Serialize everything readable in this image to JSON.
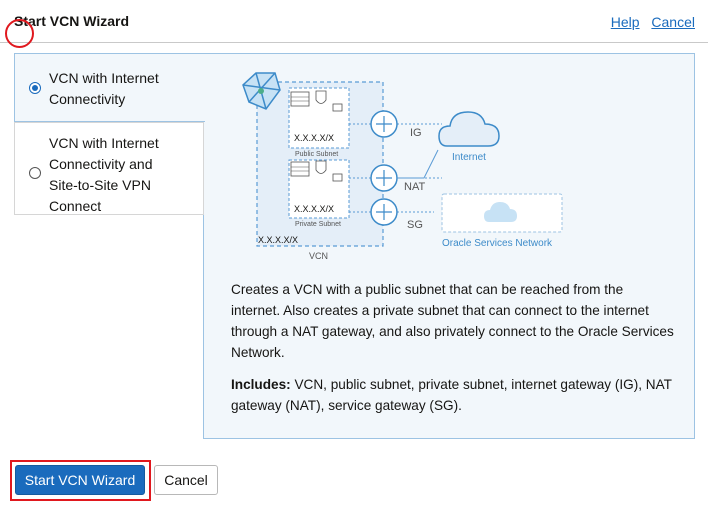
{
  "header": {
    "title": "Start VCN Wizard",
    "help_link": "Help",
    "cancel_link": "Cancel"
  },
  "options": [
    {
      "label_line1": "VCN with Internet",
      "label_line2": "Connectivity",
      "selected": true
    },
    {
      "label_line1": "VCN with Internet",
      "label_line2": "Connectivity and",
      "label_line3": "Site-to-Site VPN",
      "label_line4": "Connect",
      "selected": false
    }
  ],
  "diagram": {
    "public_subnet_cidr": "X.X.X.X/X",
    "public_subnet_label": "Public Subnet",
    "private_subnet_cidr": "X.X.X.X/X",
    "private_subnet_label": "Private Subnet",
    "vcn_cidr": "X.X.X.X/X",
    "vcn_label": "VCN",
    "ig_label": "IG",
    "nat_label": "NAT",
    "sg_label": "SG",
    "internet_label": "Internet",
    "osn_label": "Oracle Services Network",
    "accent_color": "#5a9bd5"
  },
  "description": {
    "text": "Creates a VCN with a public subnet that can be reached from the internet. Also creates a private subnet that can connect to the internet through a NAT gateway, and also privately connect to the Oracle Services Network.",
    "includes_label": "Includes:",
    "includes_text": " VCN, public subnet, private subnet, internet gateway (IG), NAT gateway (NAT), service gateway (SG)."
  },
  "buttons": {
    "start_label": "Start VCN Wizard",
    "cancel_label": "Cancel"
  }
}
